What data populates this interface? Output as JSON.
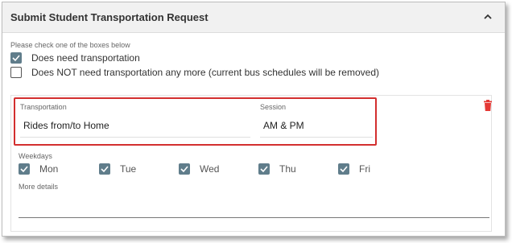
{
  "panel": {
    "title": "Submit Student Transportation Request"
  },
  "options": {
    "instruction": "Please check one of the boxes below",
    "need": {
      "label": "Does need transportation",
      "checked": true
    },
    "not_need": {
      "label": "Does NOT need transportation any more (current bus schedules will be removed)",
      "checked": false
    }
  },
  "request": {
    "transportation": {
      "label": "Transportation",
      "value": "Rides from/to Home"
    },
    "session": {
      "label": "Session",
      "value": "AM & PM"
    },
    "weekdays_label": "Weekdays",
    "weekdays": [
      {
        "label": "Mon",
        "checked": true
      },
      {
        "label": "Tue",
        "checked": true
      },
      {
        "label": "Wed",
        "checked": true
      },
      {
        "label": "Thu",
        "checked": true
      },
      {
        "label": "Fri",
        "checked": true
      }
    ],
    "more_details_label": "More details",
    "more_details_value": ""
  },
  "colors": {
    "checkbox": "#607d8b",
    "highlight": "#d32f2f",
    "trash": "#e53935"
  }
}
